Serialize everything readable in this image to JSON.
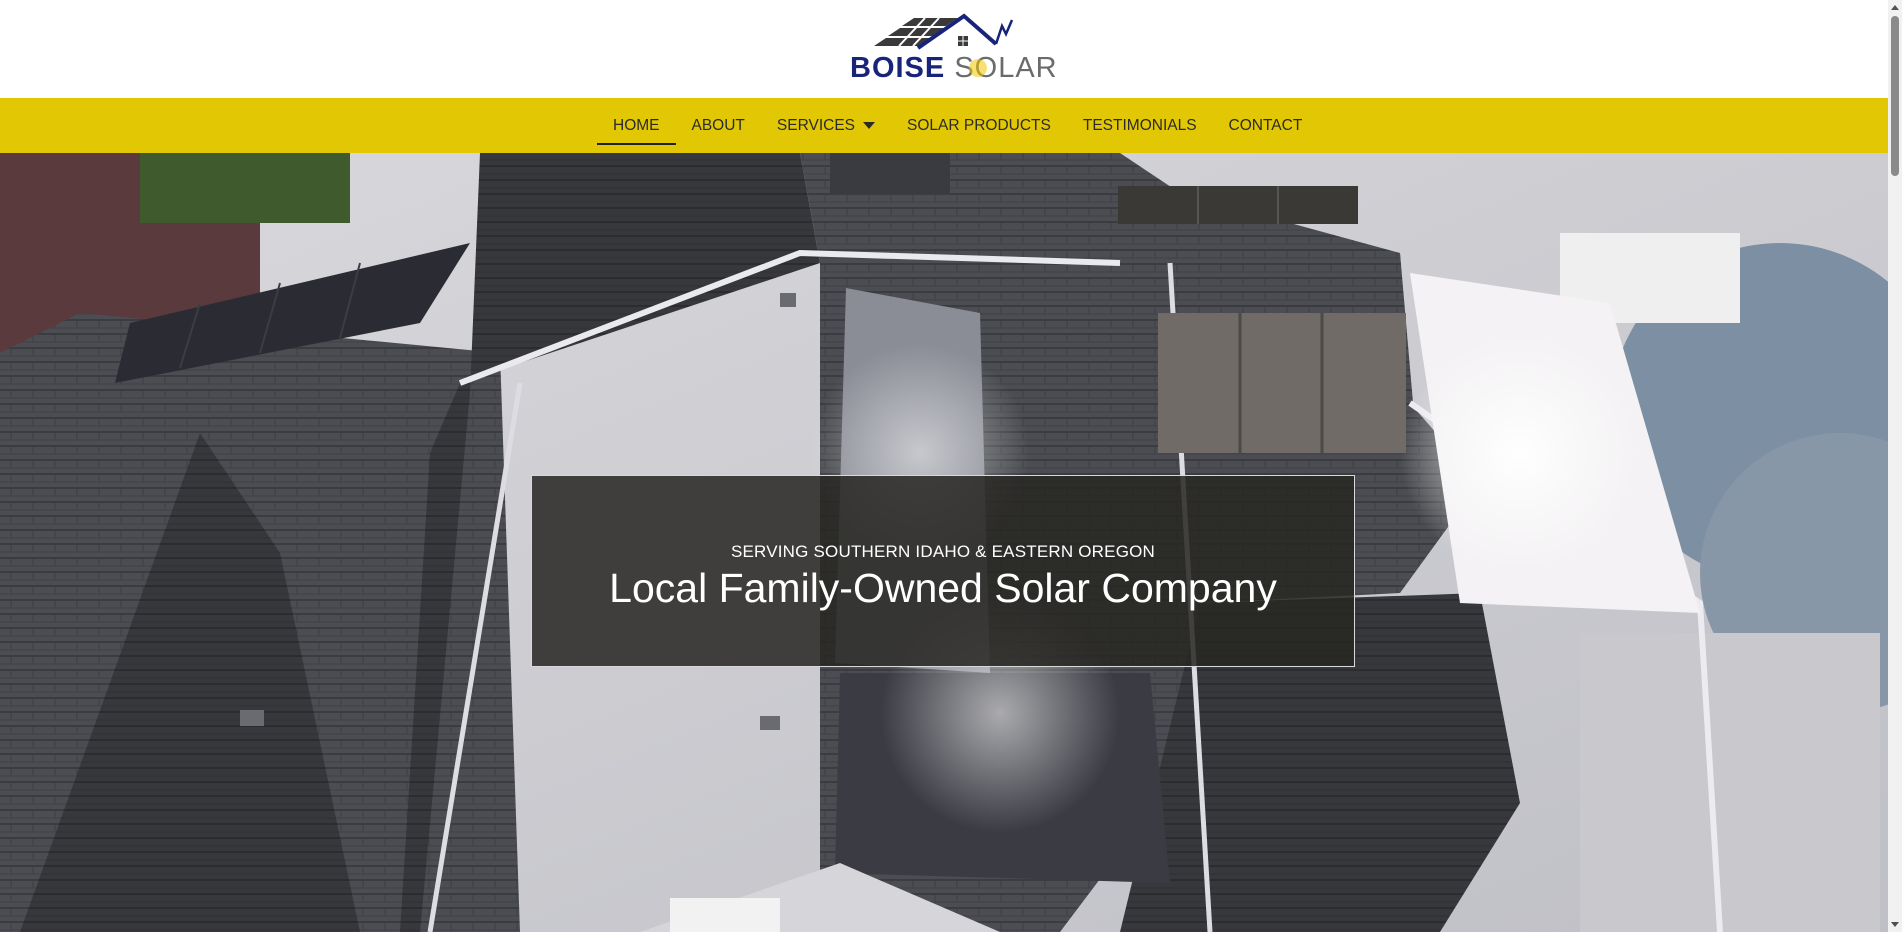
{
  "brand": {
    "name_part1": "BOISE",
    "name_part2": "SOLAR",
    "logo_icon": "solar-house-logo-icon",
    "primary_color": "#17247a",
    "secondary_color": "#6b6b6b",
    "sun_color": "#f2c600"
  },
  "nav": {
    "background": "#e2c804",
    "items": [
      {
        "label": "HOME",
        "active": true
      },
      {
        "label": "ABOUT",
        "active": false
      },
      {
        "label": "SERVICES",
        "active": false,
        "has_dropdown": true,
        "icon": "caret-down-icon"
      },
      {
        "label": "SOLAR PRODUCTS",
        "active": false
      },
      {
        "label": "TESTIMONIALS",
        "active": false
      },
      {
        "label": "CONTACT",
        "active": false
      }
    ]
  },
  "hero": {
    "kicker": "SERVING SOUTHERN IDAHO & EASTERN OREGON",
    "title": "Local Family-Owned Solar Company",
    "background_image": "aerial-rooftop-solar-panels-photo"
  }
}
